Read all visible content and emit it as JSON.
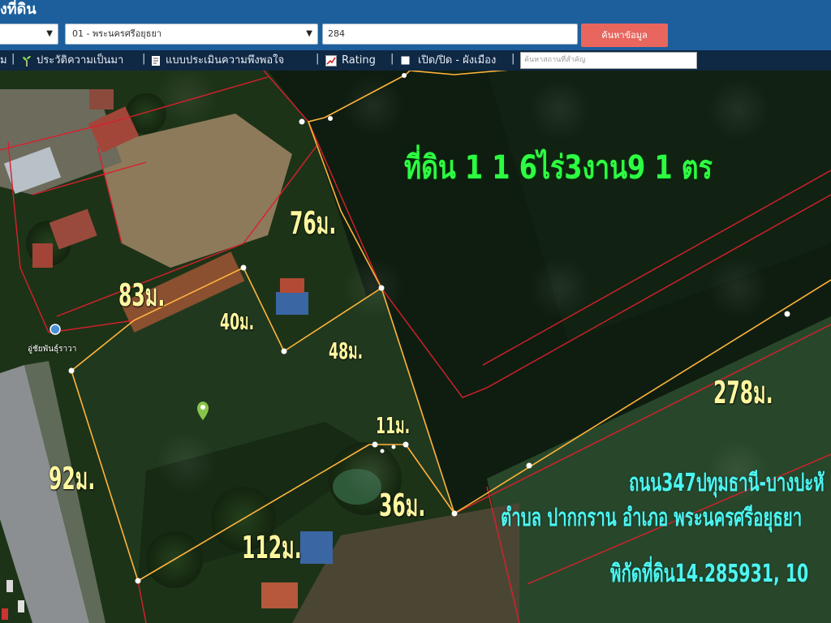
{
  "header": {
    "title": "งที่ดิน",
    "province_select": "",
    "amphoe_select": "01 - พระนครศรีอยุธยา",
    "parcel_number": "284",
    "search_button": "ค้นหาข้อมูล"
  },
  "toolbar": {
    "item_partial": "ม",
    "history": "ประวัติความเป็นมา",
    "survey": "แบบประเมินความพึงพอใจ",
    "rating": "Rating",
    "toggle_layer": "เปิด/ปิด - ผังเมือง",
    "place_search_placeholder": "ค้นหาสถานที่สำคัญ"
  },
  "map": {
    "area_label": "ที่ดิน 1 1 6ไร่3งาน9 1 ตร",
    "road_info": "ถนน347ปทุมธานี-บางปะหั",
    "location_info": "ตำบล ปากกราน อำเภอ พระนครศรีอยุธยา",
    "coordinates_info": "พิกัดที่ดิน14.285931, 10",
    "place_label": "อู่ชัยพันธุ์ราวา",
    "dimensions": {
      "d76": "76ม.",
      "d83": "83ม.",
      "d40": "40ม.",
      "d48": "48ม.",
      "d278": "278ม.",
      "d11": "11ม.",
      "d92": "92ม.",
      "d36": "36ม.",
      "d112": "112ม."
    }
  },
  "colors": {
    "header_bg": "#1d5f9c",
    "toolbar_bg": "#0f2844",
    "search_button": "#e8665e",
    "boundary": "#ffb43c",
    "cadastral": "#d8202c",
    "area_text": "#2dfd42",
    "info_text": "#4ef5f0",
    "dimension_text": "#fff7a0"
  }
}
